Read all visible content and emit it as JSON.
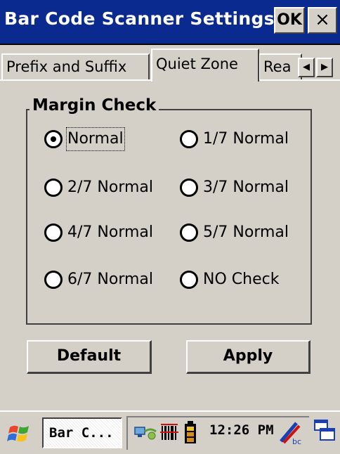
{
  "window": {
    "title": "Bar Code Scanner Settings",
    "ok_label": "OK",
    "close_label": "×"
  },
  "tabs": [
    {
      "label": "Prefix and Suffix",
      "active": false
    },
    {
      "label": "Quiet Zone",
      "active": true
    },
    {
      "label": "Rea",
      "active": false
    }
  ],
  "tab_scroll": {
    "left_icon": "◀",
    "right_icon": "▶"
  },
  "margin_check": {
    "legend": "Margin Check",
    "options": [
      {
        "label": "Normal",
        "selected": true
      },
      {
        "label": "1/7 Normal",
        "selected": false
      },
      {
        "label": "2/7 Normal",
        "selected": false
      },
      {
        "label": "3/7 Normal",
        "selected": false
      },
      {
        "label": "4/7 Normal",
        "selected": false
      },
      {
        "label": "5/7 Normal",
        "selected": false
      },
      {
        "label": "6/7 Normal",
        "selected": false
      },
      {
        "label": "NO Check",
        "selected": false
      }
    ]
  },
  "buttons": {
    "default_label": "Default",
    "apply_label": "Apply"
  },
  "taskbar": {
    "task_label": "Bar C...",
    "clock": "12:26 PM"
  },
  "colors": {
    "titlebar": "#0b2a8f",
    "face": "#d4d0c8"
  }
}
